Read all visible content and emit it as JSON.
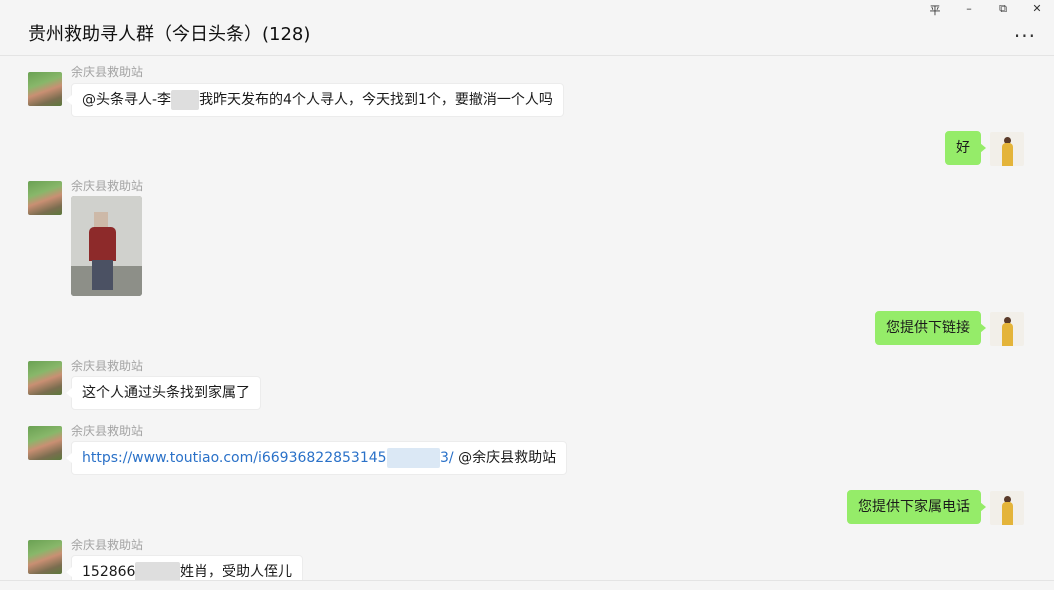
{
  "window": {
    "title": "贵州救助寻人群（今日头条）(128)",
    "more_label": "···",
    "controls": {
      "pin": "平",
      "minimize": "–",
      "restore": "⧉",
      "close": "✕"
    }
  },
  "messages": [
    {
      "sender": "余庆县救助站",
      "text_before": "@头条寻人-李",
      "text_redacted": "某某",
      "text_after": "我昨天发布的4个人寻人，今天找到1个，要撤消一个人吗"
    },
    {
      "text": "好"
    },
    {
      "sender": "余庆县救助站",
      "image": "photo-of-person"
    },
    {
      "text": "您提供下链接"
    },
    {
      "sender": "余庆县救助站",
      "text": "这个人通过头条找到家属了"
    },
    {
      "sender": "余庆县救助站",
      "link_before": "https://www.toutiao.com/i66936822853145",
      "link_redacted": "000000",
      "link_after": "3/",
      "text_after": " @余庆县救助站"
    },
    {
      "text": "您提供下家属电话"
    },
    {
      "sender": "余庆县救助站",
      "text_before": "152866",
      "text_redacted": "00000",
      "text_after": "姓肖，受助人侄儿"
    }
  ]
}
